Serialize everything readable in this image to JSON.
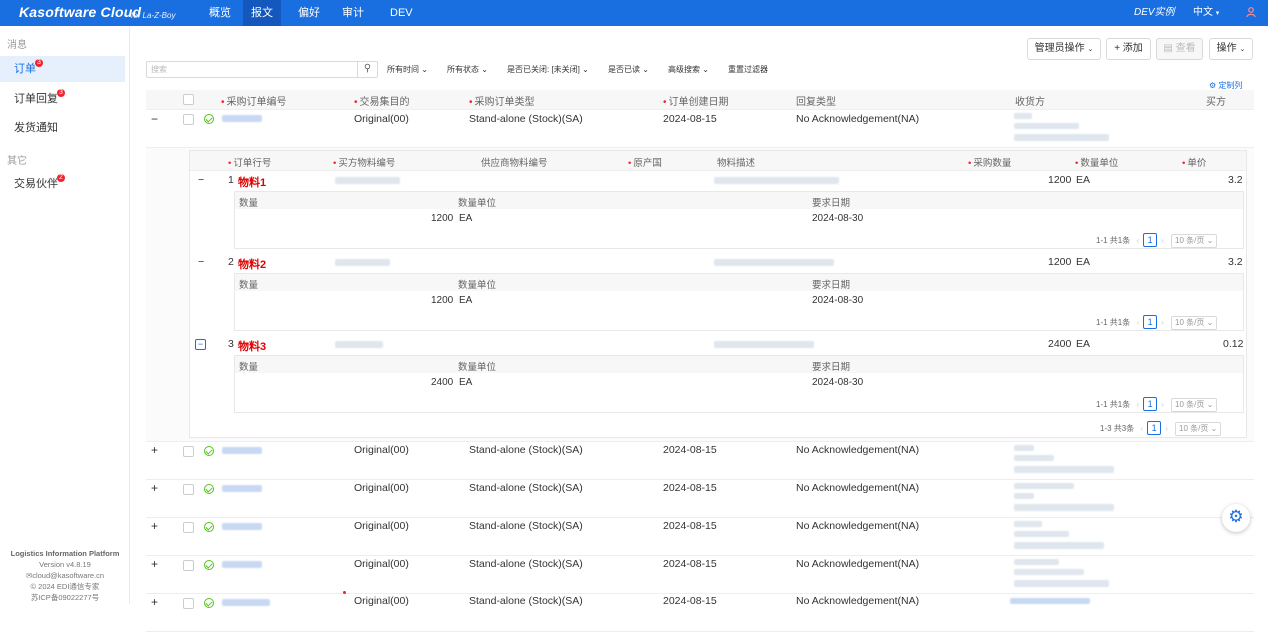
{
  "topbar": {
    "brand": "Kasoftware Cloud",
    "brand_sub": "for La-Z-Boy",
    "nav": [
      "概览",
      "报文",
      "偏好",
      "审计",
      "DEV"
    ],
    "active_nav": "报文",
    "env": "DEV实例",
    "lang": "中文",
    "lang_icon": "chevron-down-icon",
    "user_icon": "user-icon"
  },
  "sidebar": {
    "group1": "消息",
    "items": [
      {
        "label": "订单",
        "badge": "3"
      },
      {
        "label": "订单回复",
        "badge": "3"
      },
      {
        "label": "发货通知",
        "badge": ""
      }
    ],
    "group2": "其它",
    "items2": [
      {
        "label": "交易伙伴",
        "badge": "2"
      }
    ],
    "footer": [
      "Logistics Information Platform",
      "Version v4.8.19",
      "✉cloud@kasoftware.cn",
      "© 2024 EDI通信专家",
      "苏ICP备09022277号"
    ]
  },
  "actions": {
    "admin": "管理员操作",
    "add": "+ 添加",
    "view": "查看",
    "ops": "操作"
  },
  "search": {
    "placeholder": "搜索"
  },
  "filters": [
    "所有时间",
    "所有状态",
    "是否已关闭: [未关闭]",
    "是否已读",
    "高级搜索",
    "重置过滤器"
  ],
  "customize": "定制列",
  "table": {
    "columns": [
      "采购订单编号",
      "交易集目的",
      "采购订单类型",
      "订单创建日期",
      "回复类型",
      "收货方",
      "买方"
    ],
    "rows": [
      {
        "purpose": "Original(00)",
        "type": "Stand-alone (Stock)(SA)",
        "date": "2024-08-15",
        "reply": "No Acknowledgement(NA)"
      },
      {
        "purpose": "Original(00)",
        "type": "Stand-alone (Stock)(SA)",
        "date": "2024-08-15",
        "reply": "No Acknowledgement(NA)"
      },
      {
        "purpose": "Original(00)",
        "type": "Stand-alone (Stock)(SA)",
        "date": "2024-08-15",
        "reply": "No Acknowledgement(NA)"
      },
      {
        "purpose": "Original(00)",
        "type": "Stand-alone (Stock)(SA)",
        "date": "2024-08-15",
        "reply": "No Acknowledgement(NA)"
      },
      {
        "purpose": "Original(00)",
        "type": "Stand-alone (Stock)(SA)",
        "date": "2024-08-15",
        "reply": "No Acknowledgement(NA)"
      },
      {
        "purpose": "Original(00)",
        "type": "Stand-alone (Stock)(SA)",
        "date": "2024-08-15",
        "reply": "No Acknowledgement(NA)"
      }
    ]
  },
  "lines": {
    "columns": [
      "订单行号",
      "买方物料编号",
      "供应商物料编号",
      "原产国",
      "物料描述",
      "采购数量",
      "数量单位",
      "单价"
    ],
    "items": [
      {
        "no": "1",
        "name": "物料1",
        "qty": "1200",
        "unit": "EA",
        "price": "3.2",
        "sched_qty": "1200",
        "sched_unit": "EA",
        "sched_date": "2024-08-30"
      },
      {
        "no": "2",
        "name": "物料2",
        "qty": "1200",
        "unit": "EA",
        "price": "3.2",
        "sched_qty": "1200",
        "sched_unit": "EA",
        "sched_date": "2024-08-30"
      },
      {
        "no": "3",
        "name": "物料3",
        "qty": "2400",
        "unit": "EA",
        "price": "0.12",
        "sched_qty": "2400",
        "sched_unit": "EA",
        "sched_date": "2024-08-30"
      }
    ],
    "sched_columns": [
      "数量",
      "数量单位",
      "要求日期"
    ],
    "sub_total": "1-1 共1条",
    "page": "1",
    "page_size": "10 条/页",
    "lines_total": "1-3 共3条"
  }
}
